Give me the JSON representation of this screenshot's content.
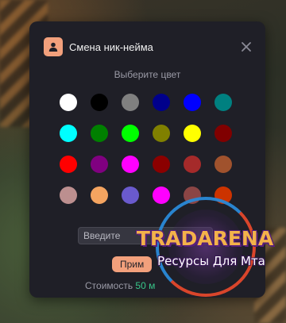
{
  "dialog": {
    "title": "Смена ник-нейма",
    "close_icon": "close-icon",
    "user_icon": "user-icon",
    "accent_color": "#f2a07c"
  },
  "color_picker": {
    "label": "Выберите цвет",
    "colors": [
      "#ffffff",
      "#000000",
      "#808080",
      "#00008b",
      "#0000ff",
      "#008080",
      "#00ffff",
      "#008000",
      "#00ff00",
      "#808000",
      "#ffff00",
      "#800000",
      "#ff0000",
      "#800080",
      "#ff00ff",
      "#8b0000",
      "#a52a2a",
      "#a0522d",
      "#bc8f8f",
      "#f4a460",
      "#6a5acd",
      "#ff00ff",
      "#8b4545",
      "#cc3300"
    ]
  },
  "nickname_input": {
    "placeholder": "Введите"
  },
  "apply_button": {
    "label": "Прим"
  },
  "cost": {
    "label": "Стоимость",
    "value": "50 м"
  },
  "watermark": {
    "title": "TRADARENA",
    "subtitle": "Ресурсы Для Мта"
  }
}
